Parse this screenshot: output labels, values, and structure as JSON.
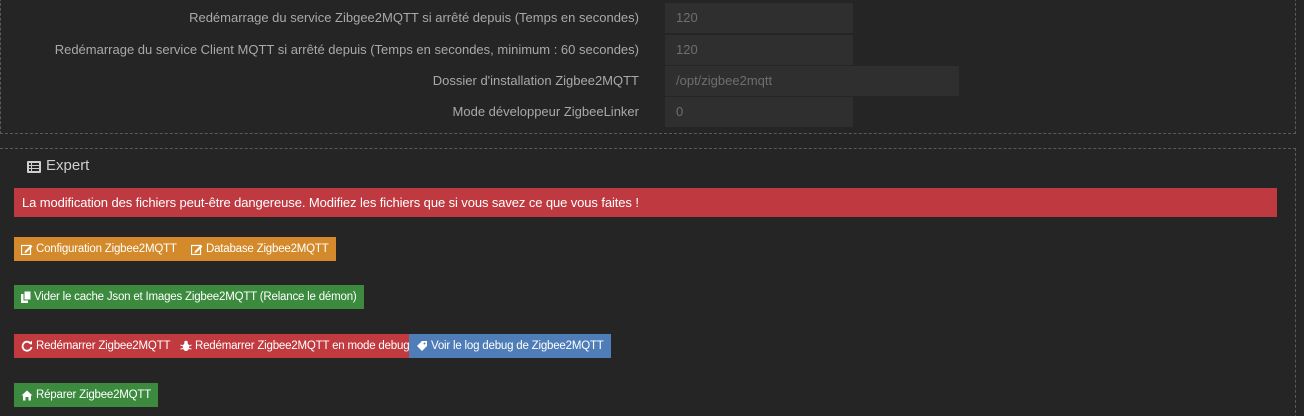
{
  "config_rows": [
    {
      "label": "Redémarrage du service Zibgee2MQTT si arrêté depuis (Temps en secondes)",
      "value": "120"
    },
    {
      "label": "Redémarrage du service Client MQTT si arrêté depuis (Temps en secondes, minimum : 60 secondes)",
      "value": "120"
    },
    {
      "label": "Dossier d'installation Zigbee2MQTT",
      "value": "/opt/zigbee2mqtt"
    },
    {
      "label": "Mode développeur ZigbeeLinker",
      "value": "0"
    }
  ],
  "expert": {
    "title": "Expert",
    "icon": "list-icon",
    "alert": "La modification des fichiers peut-être dangereuse. Modifiez les fichiers que si vous savez ce que vous faites !",
    "alert_color": "#bf3a40"
  },
  "buttons": {
    "config": "Configuration Zigbee2MQTT",
    "database": "Database Zigbee2MQTT",
    "clear_cache": "Vider le cache Json et Images Zigbee2MQTT (Relance le démon)",
    "restart": "Redémarrer Zigbee2MQTT",
    "restart_debug": "Redémarrer Zigbee2MQTT en mode debug",
    "view_log": "Voir le log debug de Zigbee2MQTT",
    "repair": "Réparer Zigbee2MQTT"
  },
  "colors": {
    "warning": "#d48a2a",
    "success": "#3b8a3e",
    "danger": "#c13a3f",
    "info": "#4f7db8"
  }
}
